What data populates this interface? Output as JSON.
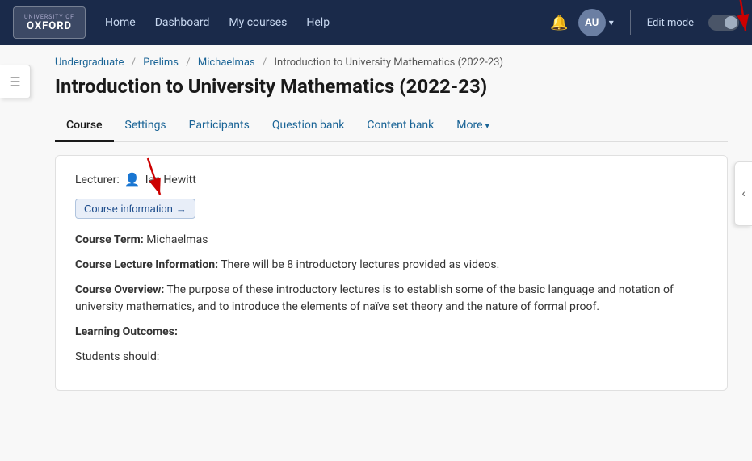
{
  "navbar": {
    "logo_top": "UNIVERSITY OF",
    "logo_main": "OXFORD",
    "nav_items": [
      "Home",
      "Dashboard",
      "My courses",
      "Help"
    ],
    "user_initials": "AU",
    "edit_mode_label": "Edit mode"
  },
  "breadcrumb": {
    "items": [
      "Undergraduate",
      "Prelims",
      "Michaelmas",
      "Introduction to University Mathematics (2022-23)"
    ]
  },
  "page": {
    "title": "Introduction to University Mathematics (2022-23)"
  },
  "tabs": [
    {
      "label": "Course",
      "active": true
    },
    {
      "label": "Settings",
      "active": false
    },
    {
      "label": "Participants",
      "active": false
    },
    {
      "label": "Question bank",
      "active": false
    },
    {
      "label": "Content bank",
      "active": false
    },
    {
      "label": "More",
      "active": false,
      "has_arrow": true
    }
  ],
  "course_card": {
    "lecturer_label": "Lecturer:",
    "lecturer_name": "Ian Hewitt",
    "course_info_btn": "Course information",
    "course_info_arrow": "→",
    "details": [
      {
        "label": "Course Term:",
        "text": " Michaelmas"
      },
      {
        "label": "Course Lecture Information:",
        "text": " There will be 8 introductory lectures provided as videos."
      },
      {
        "label": "Course Overview:",
        "text": " The purpose of these introductory lectures is to establish some of the basic language and notation of university mathematics, and to introduce the elements of naïve set theory and the nature of formal proof."
      },
      {
        "label": "Learning Outcomes:",
        "text": ""
      }
    ],
    "learning_outcomes_sub": "Students should:"
  }
}
